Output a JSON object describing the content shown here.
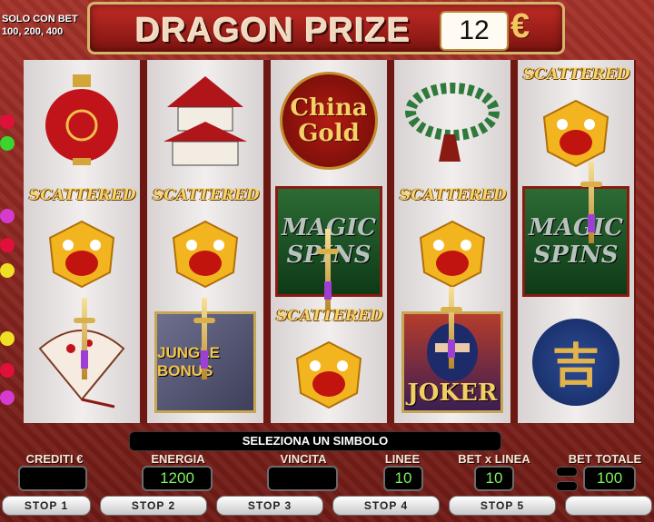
{
  "header": {
    "bet_note_line1": "SOLO CON BET",
    "bet_note_line2": "100, 200, 400",
    "title": "DRAGON PRIZE",
    "prize_value": "12",
    "currency_symbol": "€"
  },
  "reels": [
    {
      "symbols": [
        {
          "name": "red lantern",
          "label": ""
        },
        {
          "name": "scattered dragon",
          "label": "SCATTERED"
        },
        {
          "name": "fan",
          "label": ""
        }
      ]
    },
    {
      "symbols": [
        {
          "name": "pagoda",
          "label": ""
        },
        {
          "name": "scattered dragon",
          "label": "SCATTERED"
        },
        {
          "name": "jungle bonus",
          "label": "JUNGLE BONUS"
        }
      ]
    },
    {
      "symbols": [
        {
          "name": "china gold",
          "label_line1": "China",
          "label_line2": "Gold"
        },
        {
          "name": "magic spins",
          "label_line1": "MAGIC",
          "label_line2": "SPINS"
        },
        {
          "name": "scattered dragon",
          "label": "SCATTERED"
        }
      ]
    },
    {
      "symbols": [
        {
          "name": "jade beads",
          "label": ""
        },
        {
          "name": "scattered dragon",
          "label": "SCATTERED"
        },
        {
          "name": "ninja joker",
          "label": "JOKER"
        }
      ]
    },
    {
      "symbols": [
        {
          "name": "scattered dragon",
          "label": "SCATTERED"
        },
        {
          "name": "magic spins",
          "label_line1": "MAGIC",
          "label_line2": "SPINS"
        },
        {
          "name": "kanji coin",
          "label": "吉"
        }
      ]
    }
  ],
  "message": "SELEZIONA UN SIMBOLO",
  "panel": {
    "crediti": {
      "label": "CREDITI €",
      "value": ""
    },
    "energia": {
      "label": "ENERGIA",
      "value": "1200"
    },
    "vincita": {
      "label": "VINCITA",
      "value": ""
    },
    "linee": {
      "label": "LINEE",
      "value": "10"
    },
    "bet_linea": {
      "label": "BET x LINEA",
      "value": "10"
    },
    "bet_totale": {
      "label": "BET TOTALE",
      "value": "100"
    }
  },
  "buttons": {
    "stop1": "STOP 1",
    "stop2": "STOP 2",
    "stop3": "STOP 3",
    "stop4": "STOP 4",
    "stop5": "STOP 5",
    "extra": ""
  },
  "colors": {
    "display_text": "#7cf05e",
    "gold": "#f3c760",
    "frame": "#7a1f1a"
  }
}
